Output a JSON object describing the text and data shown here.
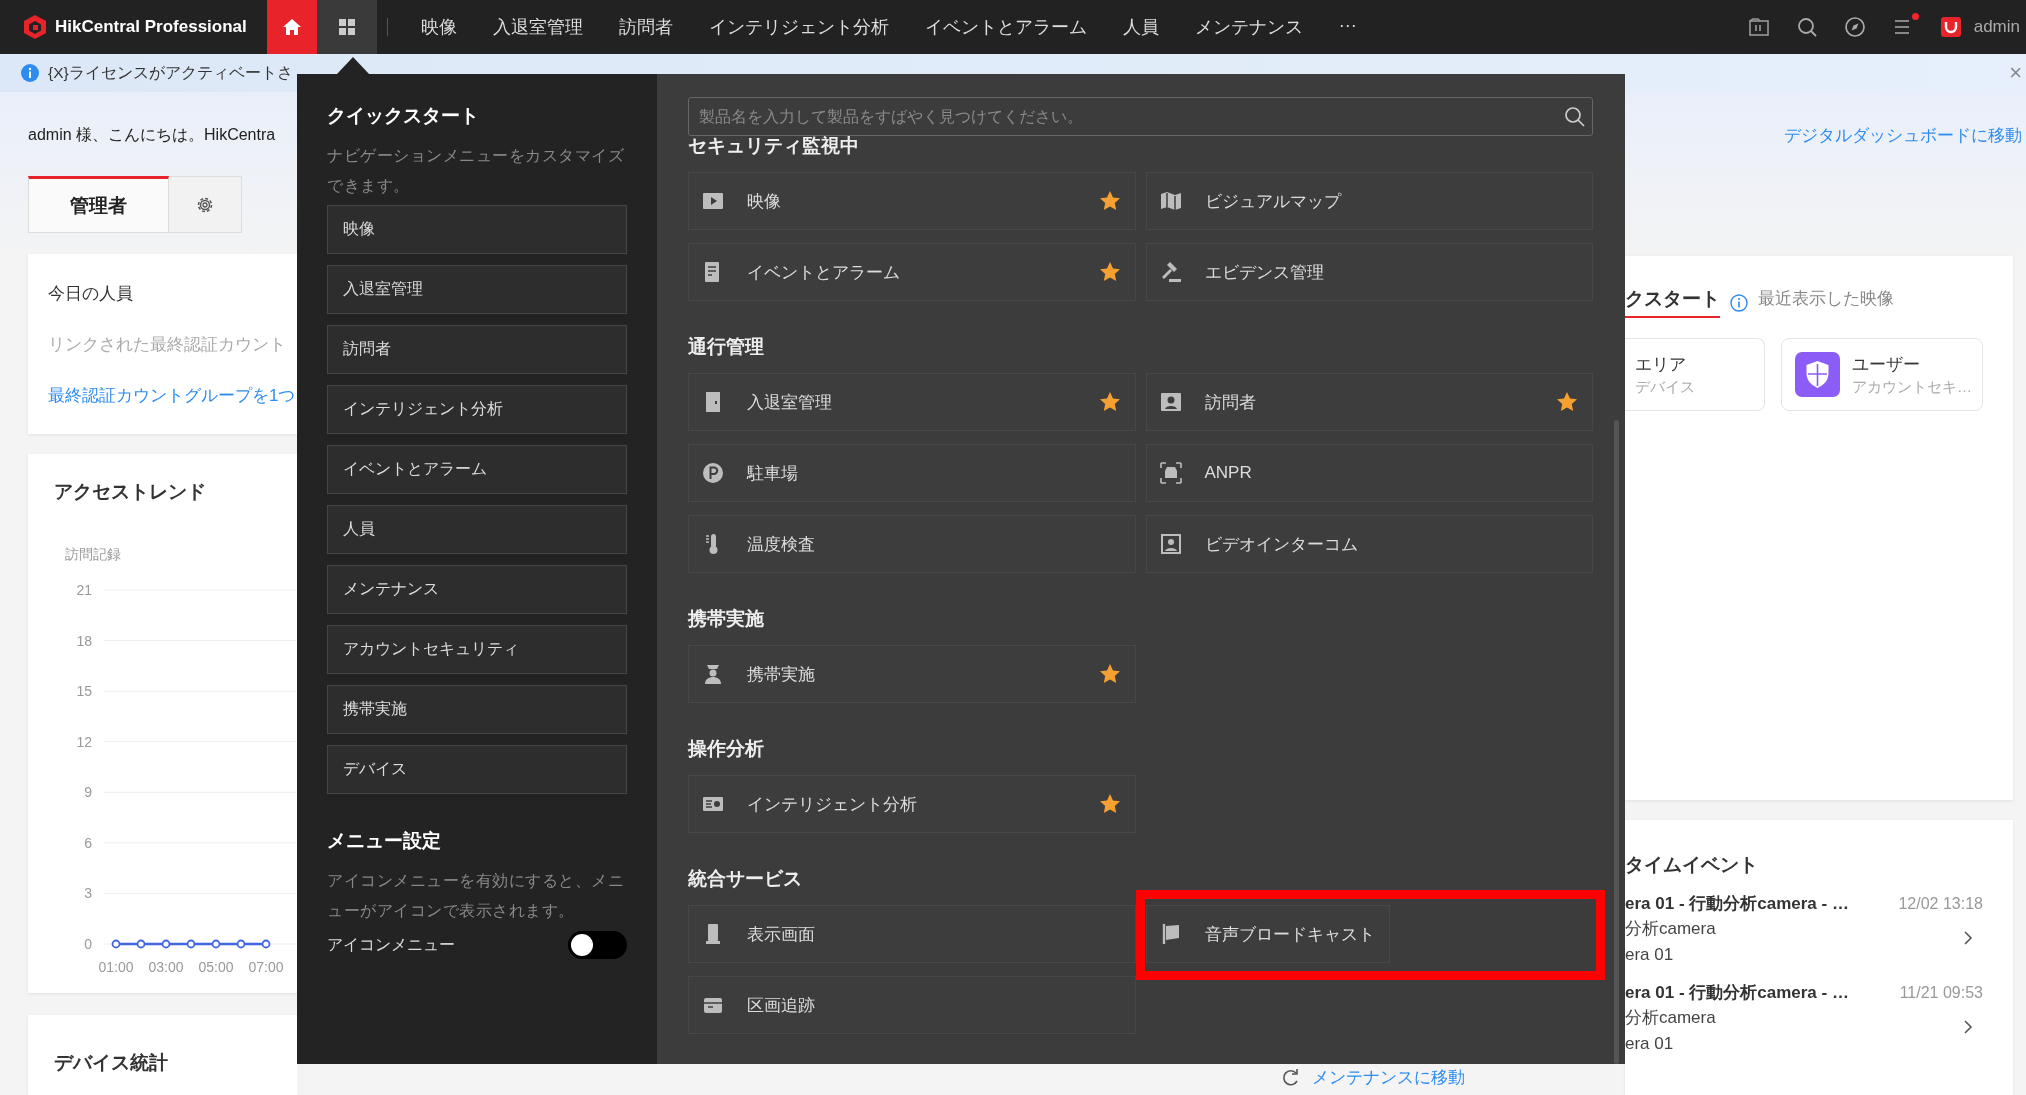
{
  "top_bar": {
    "brand": "HikCentral Professional",
    "nav_buttons": [
      {
        "kind": "home",
        "selected": true,
        "expanded": false
      },
      {
        "kind": "apps",
        "selected": false,
        "expanded": true
      }
    ],
    "menu": [
      "映像",
      "入退室管理",
      "訪問者",
      "インテリジェント分析",
      "イベントとアラーム",
      "人員",
      "メンテナンス",
      "···"
    ],
    "tools": [
      {
        "kind": "files",
        "badge": false
      },
      {
        "kind": "search",
        "badge": false
      },
      {
        "kind": "compass",
        "badge": false
      },
      {
        "kind": "list",
        "badge": true
      },
      {
        "kind": "store",
        "badge": false
      }
    ],
    "user": "admin"
  },
  "notice": {
    "text": "{X}ライセンスがアクティベートさ",
    "close": "×"
  },
  "greeting": "admin 様、こんにちは。HikCentra",
  "role_tabs": [
    {
      "kind": "text",
      "label": "管理者",
      "selected": true
    },
    {
      "kind": "settings",
      "selected": false
    }
  ],
  "today_card": {
    "title": "今日の人員",
    "hint": "リンクされた最終認証カウント",
    "link": "最終認証カウントグループを1つ"
  },
  "trend_card": {
    "title": "アクセストレンド",
    "chart_data": {
      "type": "line",
      "ylabel": "訪問記録",
      "x": [
        1,
        2,
        3,
        4,
        5,
        6,
        7
      ],
      "series": [
        {
          "color": "#4166e0",
          "marker": "circle",
          "values": [
            0,
            0,
            0,
            0,
            0,
            0,
            0
          ]
        }
      ],
      "xlim": [
        0.5,
        8.2
      ],
      "ylim": [
        0,
        21
      ],
      "grid": true,
      "yticks": [
        0,
        3,
        6,
        9,
        12,
        15,
        18,
        21
      ],
      "xticks": [
        {
          "value": 1,
          "label": "01:00"
        },
        {
          "value": 3,
          "label": "03:00"
        },
        {
          "value": 5,
          "label": "05:00"
        },
        {
          "value": 7,
          "label": "07:00"
        }
      ]
    }
  },
  "device_card": {
    "title": "デバイス統計"
  },
  "dashboard_link": "デジタルダッシュボードに移動",
  "quick_card": {
    "tabs": [
      {
        "label": "クスタート",
        "selected": true
      },
      {
        "label": "最近表示した映像",
        "selected": false
      }
    ],
    "tiles": [
      {
        "kind": "cut",
        "title": "エリア",
        "subtitle": "デバイス"
      },
      {
        "kind": "shield",
        "title": "ユーザー",
        "subtitle": "アカウントセキ…"
      }
    ]
  },
  "events_card": {
    "title": "タイムイベント",
    "events": [
      {
        "title": "era 01 - 行動分析camera - …",
        "time": "12/02 13:18",
        "details": [
          "分析camera",
          "era 01"
        ]
      },
      {
        "title": "era 01 - 行動分析camera - …",
        "time": "11/21 09:53",
        "details": [
          "分析camera",
          "era 01"
        ]
      }
    ]
  },
  "maintenance_link": "メンテナンスに移動",
  "quick_menu": {
    "title": "クイックスタート",
    "description": "ナビゲーションメニューをカスタマイズできます。",
    "items": [
      "映像",
      "入退室管理",
      "訪問者",
      "インテリジェント分析",
      "イベントとアラーム",
      "人員",
      "メンテナンス",
      "アカウントセキュリティ",
      "携帯実施",
      "デバイス"
    ],
    "settings_title": "メニュー設定",
    "settings_description": "アイコンメニューを有効にすると、メニューがアイコンで表示されます。",
    "toggle": {
      "label": "アイコンメニュー",
      "on": false
    }
  },
  "catalog": {
    "search": {
      "placeholder": "製品名を入力して製品をすばやく見つけてください。"
    },
    "sections": [
      {
        "title": "セキュリティ監視中",
        "items": [
          {
            "label": "映像",
            "kind": "play",
            "starred": true,
            "highlighted": false
          },
          {
            "label": "ビジュアルマップ",
            "kind": "map",
            "starred": false,
            "highlighted": false
          },
          {
            "label": "イベントとアラーム",
            "kind": "document",
            "starred": true,
            "highlighted": false
          },
          {
            "label": "エビデンス管理",
            "kind": "gavel",
            "starred": false,
            "highlighted": false
          }
        ]
      },
      {
        "title": "通行管理",
        "items": [
          {
            "label": "入退室管理",
            "kind": "door",
            "starred": true,
            "highlighted": false
          },
          {
            "label": "訪問者",
            "kind": "person",
            "starred": true,
            "highlighted": false
          },
          {
            "label": "駐車場",
            "kind": "parking",
            "starred": false,
            "highlighted": false
          },
          {
            "label": "ANPR",
            "kind": "car",
            "starred": false,
            "highlighted": false
          },
          {
            "label": "温度検査",
            "kind": "thermometer",
            "starred": false,
            "highlighted": false
          },
          {
            "label": "ビデオインターコム",
            "kind": "portrait",
            "starred": false,
            "highlighted": false
          }
        ]
      },
      {
        "title": "携帯実施",
        "items": [
          {
            "label": "携帯実施",
            "kind": "officer",
            "starred": true,
            "highlighted": false
          }
        ]
      },
      {
        "title": "操作分析",
        "items": [
          {
            "label": "インテリジェント分析",
            "kind": "analytics",
            "starred": true,
            "highlighted": false
          }
        ]
      },
      {
        "title": "統合サービス",
        "items": [
          {
            "label": "表示画面",
            "kind": "kiosk",
            "starred": false,
            "highlighted": false
          },
          {
            "label": "音声ブロードキャスト",
            "kind": "flag",
            "starred": false,
            "highlighted": true
          },
          {
            "label": "区画追跡",
            "kind": "box",
            "starred": false,
            "highlighted": false
          }
        ]
      }
    ]
  }
}
